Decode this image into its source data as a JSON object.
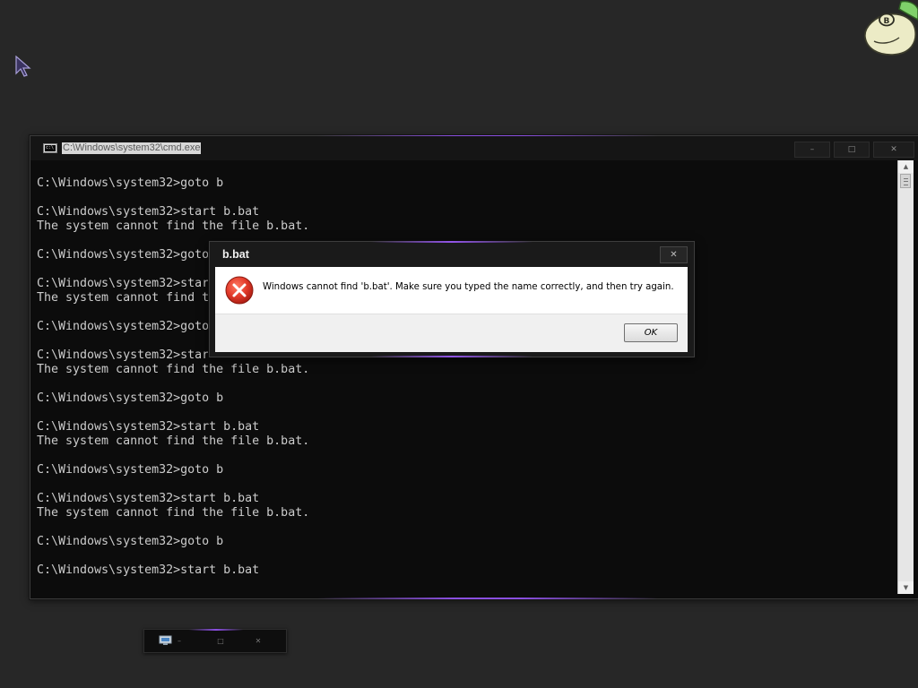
{
  "desktop": {
    "cursor_icon": "arrow-cursor-icon",
    "mascot_icon": "cartoon-mascot-icon"
  },
  "cmd": {
    "title": "C:\\Windows\\system32\\cmd.exe",
    "icon": "console-icon",
    "minimize_label": "–",
    "maximize_label": "□",
    "close_label": "✕",
    "lines": [
      "C:\\Windows\\system32>goto b",
      "",
      "C:\\Windows\\system32>start b.bat",
      "The system cannot find the file b.bat.",
      "",
      "C:\\Windows\\system32>goto b",
      "",
      "C:\\Windows\\system32>start b.bat",
      "The system cannot find the file b.bat.",
      "",
      "C:\\Windows\\system32>goto b",
      "",
      "C:\\Windows\\system32>start b.bat",
      "The system cannot find the file b.bat.",
      "",
      "C:\\Windows\\system32>goto b",
      "",
      "C:\\Windows\\system32>start b.bat",
      "The system cannot find the file b.bat.",
      "",
      "C:\\Windows\\system32>goto b",
      "",
      "C:\\Windows\\system32>start b.bat",
      "The system cannot find the file b.bat.",
      "",
      "C:\\Windows\\system32>goto b",
      "",
      "C:\\Windows\\system32>start b.bat"
    ],
    "scroll_up_label": "▲",
    "scroll_down_label": "▼"
  },
  "dialog": {
    "title": "b.bat",
    "close_label": "✕",
    "icon": "error-icon",
    "message": "Windows cannot find 'b.bat'. Make sure you typed the name correctly, and then try again.",
    "ok_label": "OK"
  },
  "minimized_window": {
    "icon": "monitor-icon",
    "minimize_label": "–",
    "maximize_label": "□",
    "close_label": "✕"
  },
  "colors": {
    "accent_glow": "#8a4fe0",
    "console_bg": "#0c0c0c",
    "console_text": "#cccccc",
    "error_red": "#e23a2a"
  }
}
